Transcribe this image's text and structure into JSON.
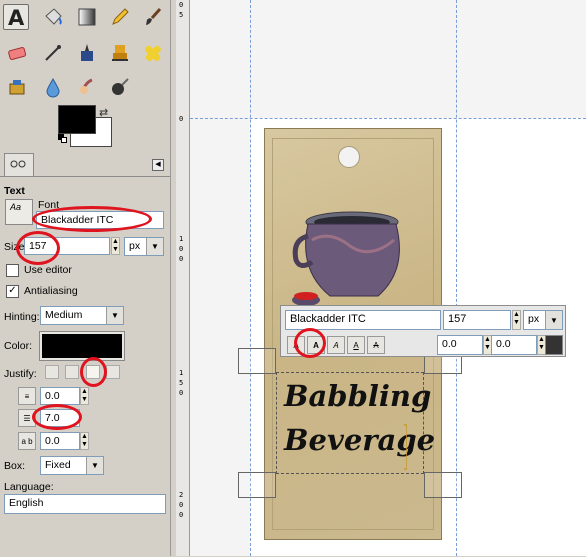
{
  "toolbox": {
    "tools": [
      "text-tool",
      "bucket-fill-tool",
      "blend-tool",
      "pencil-tool",
      "paintbrush-tool",
      "eraser-tool",
      "airbrush-tool",
      "ink-tool",
      "clone-tool",
      "heal-tool",
      "perspective-clone-tool",
      "blur-tool",
      "smudge-tool",
      "dodge-burn-tool"
    ]
  },
  "colors": {
    "foreground": "#000000",
    "background": "#ffffff",
    "highlight_red": "#e0141e"
  },
  "tool_options": {
    "section_title": "Text",
    "font_label": "Font",
    "font_value": "Blackadder ITC",
    "size_label": "Size:",
    "size_value": "157",
    "size_unit": "px",
    "use_editor_label": "Use editor",
    "use_editor_checked": false,
    "antialiasing_label": "Antialiasing",
    "antialiasing_checked": true,
    "hinting_label": "Hinting:",
    "hinting_value": "Medium",
    "color_label": "Color:",
    "justify_label": "Justify:",
    "indent_value": "0.0",
    "line_spacing_value": "7.0",
    "letter_spacing_value": "0.0",
    "box_label": "Box:",
    "box_value": "Fixed",
    "language_label": "Language:",
    "language_value": "English"
  },
  "ruler": {
    "ticks": [
      "0",
      "5",
      "1",
      "1",
      "5",
      "0",
      "0",
      "1",
      "0",
      "0",
      "1",
      "5",
      "0",
      "0",
      "2",
      "0",
      "0"
    ]
  },
  "canvas": {
    "tag_text_line1": "Babbling",
    "tag_text_line2": "Beverage"
  },
  "on_canvas_editor": {
    "font_value": "Blackadder ITC",
    "size_value": "157",
    "unit": "px",
    "baseline_value": "0.0",
    "kerning_value": "0.0"
  }
}
